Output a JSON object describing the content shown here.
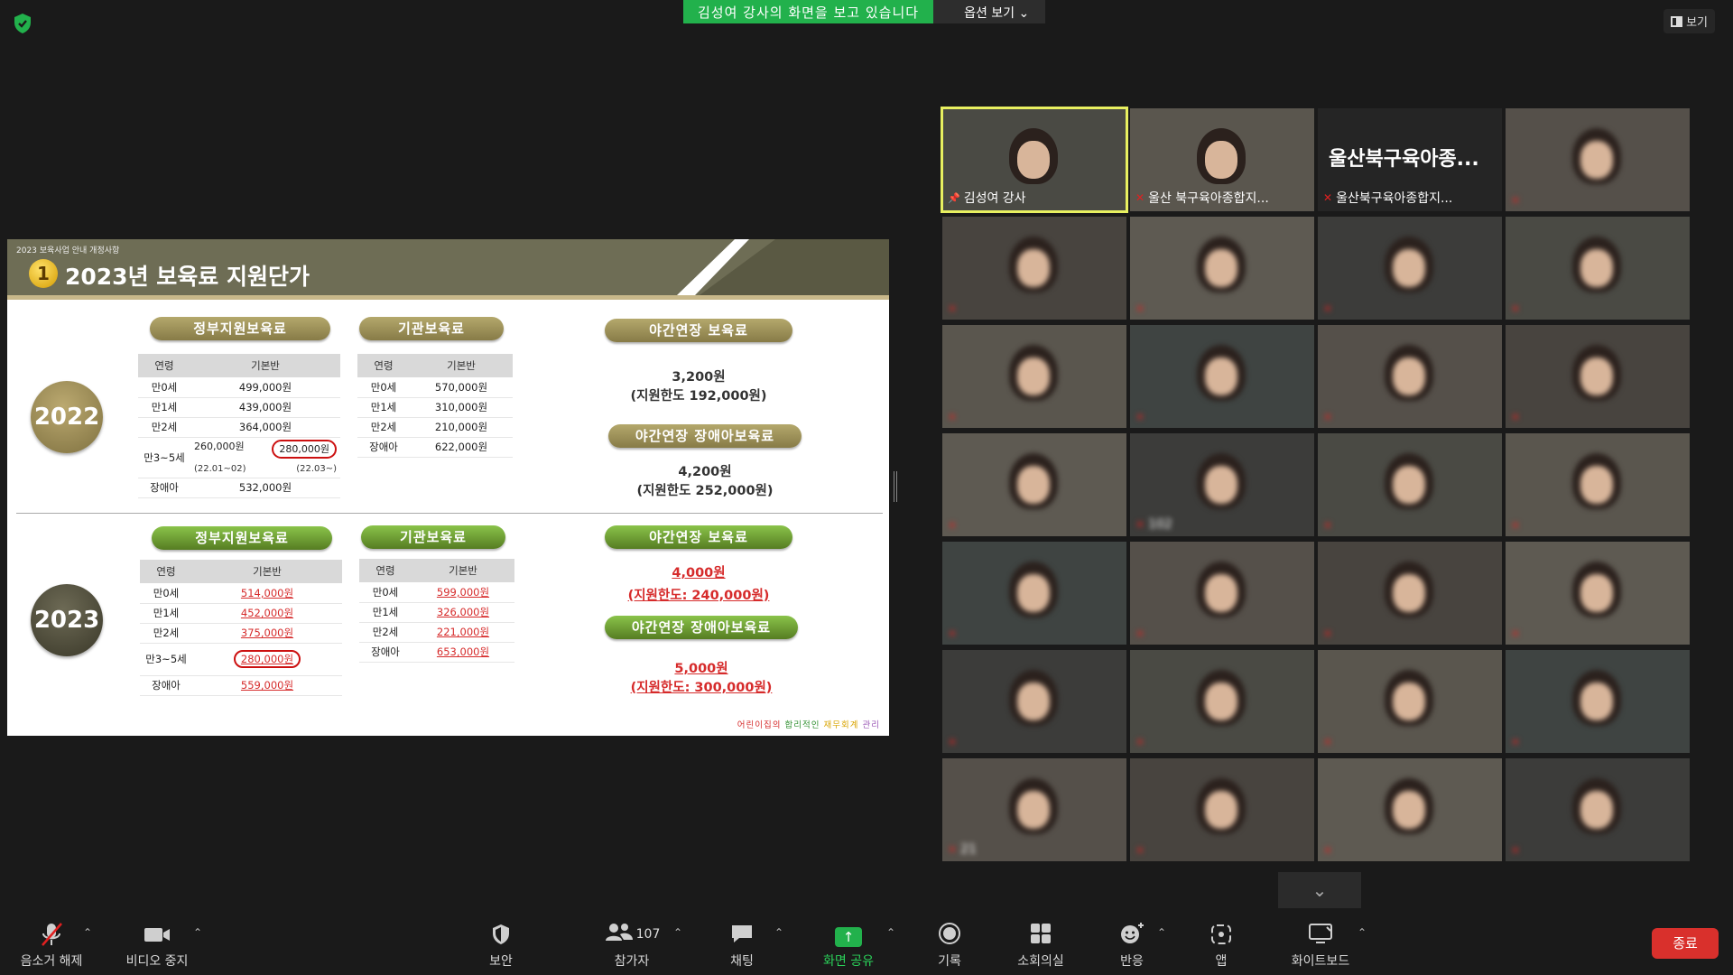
{
  "topbar": {
    "share_text": "김성여 강사의 화면을 보고 있습니다",
    "options_label": "옵션 보기 ⌄",
    "view_label": "보기"
  },
  "slide": {
    "subtitle": "2023 보육사업 안내 개정사항",
    "number": "1",
    "title": "2023년 보육료 지원단가",
    "year_2022": "2022",
    "year_2023": "2023",
    "gov_label": "정부지원보육료",
    "inst_label": "기관보육료",
    "night_label": "야간연장 보육료",
    "night_dis_label": "야간연장 장애아보육료",
    "col_age": "연령",
    "col_base": "기본반",
    "gov_2022": [
      {
        "age": "만0세",
        "value": "499,000원"
      },
      {
        "age": "만1세",
        "value": "439,000원"
      },
      {
        "age": "만2세",
        "value": "364,000원"
      }
    ],
    "gov_2022_3to5": {
      "age": "만3~5세",
      "v1": "260,000원",
      "v2": "280,000원",
      "p1": "(22.01~02)",
      "p2": "(22.03~)"
    },
    "gov_2022_dis": {
      "age": "장애아",
      "value": "532,000원"
    },
    "inst_2022": [
      {
        "age": "만0세",
        "value": "570,000원"
      },
      {
        "age": "만1세",
        "value": "310,000원"
      },
      {
        "age": "만2세",
        "value": "210,000원"
      },
      {
        "age": "장애아",
        "value": "622,000원"
      }
    ],
    "night_2022": {
      "amount": "3,200원",
      "limit": "(지원한도 192,000원)"
    },
    "night_dis_2022": {
      "amount": "4,200원",
      "limit": "(지원한도 252,000원)"
    },
    "gov_2023": [
      {
        "age": "만0세",
        "value": "514,000원"
      },
      {
        "age": "만1세",
        "value": "452,000원"
      },
      {
        "age": "만2세",
        "value": "375,000원"
      },
      {
        "age": "만3~5세",
        "value": "280,000원"
      },
      {
        "age": "장애아",
        "value": "559,000원"
      }
    ],
    "inst_2023": [
      {
        "age": "만0세",
        "value": "599,000원"
      },
      {
        "age": "만1세",
        "value": "326,000원"
      },
      {
        "age": "만2세",
        "value": "221,000원"
      },
      {
        "age": "장애아",
        "value": "653,000원"
      }
    ],
    "night_2023": {
      "amount": "4,000원",
      "limit": "(지원한도: 240,000원)"
    },
    "night_dis_2023": {
      "amount": "5,000원",
      "limit": "(지원한도: 300,000원)"
    },
    "footer": {
      "a": "어린이집의",
      "b": "합리적인",
      "c": "재무회계",
      "d": "관리"
    }
  },
  "gallery": {
    "tiles": [
      {
        "name": "김성여 강사",
        "active": true,
        "icon": "pin-icon"
      },
      {
        "name": "울산 북구육아종합지...",
        "muted": true
      },
      {
        "name": "울산북구육아종합지...",
        "muted": true,
        "big": "울산북구육아종..."
      },
      {
        "name": "",
        "muted": true,
        "blurred": true
      },
      {
        "name": "",
        "muted": true,
        "blurred": true
      },
      {
        "name": "",
        "muted": true,
        "blurred": true
      },
      {
        "name": "",
        "muted": true,
        "blurred": true
      },
      {
        "name": "",
        "muted": true,
        "blurred": true
      },
      {
        "name": "",
        "muted": true,
        "blurred": true
      },
      {
        "name": "",
        "muted": true,
        "blurred": true
      },
      {
        "name": "",
        "muted": true,
        "blurred": true
      },
      {
        "name": "",
        "muted": true,
        "blurred": true
      },
      {
        "name": "",
        "muted": true,
        "blurred": true
      },
      {
        "name": "102",
        "muted": true,
        "blurred": true
      },
      {
        "name": "",
        "muted": true,
        "blurred": true
      },
      {
        "name": "",
        "muted": true,
        "blurred": true
      },
      {
        "name": "",
        "muted": true,
        "blurred": true
      },
      {
        "name": "",
        "muted": true,
        "blurred": true
      },
      {
        "name": "",
        "muted": true,
        "blurred": true
      },
      {
        "name": "",
        "muted": true,
        "blurred": true
      },
      {
        "name": "",
        "muted": true,
        "blurred": true
      },
      {
        "name": "",
        "muted": true,
        "blurred": true
      },
      {
        "name": "",
        "muted": true,
        "blurred": true
      },
      {
        "name": "",
        "muted": true,
        "blurred": true
      },
      {
        "name": "21",
        "muted": true,
        "blurred": true
      },
      {
        "name": "",
        "muted": true,
        "blurred": true
      },
      {
        "name": "",
        "muted": true,
        "blurred": true
      },
      {
        "name": "",
        "muted": true,
        "blurred": true
      }
    ]
  },
  "toolbar": {
    "unmute": "음소거 해제",
    "video": "비디오 중지",
    "security": "보안",
    "participants": "참가자",
    "participants_count": "107",
    "chat": "채팅",
    "share": "화면 공유",
    "record": "기록",
    "breakout": "소회의실",
    "reactions": "반응",
    "apps": "앱",
    "whiteboard": "화이트보드",
    "end": "종료"
  },
  "colors": {
    "accent_green": "#22b14c",
    "end_red": "#d9302c",
    "active_outline": "#e8f060"
  }
}
